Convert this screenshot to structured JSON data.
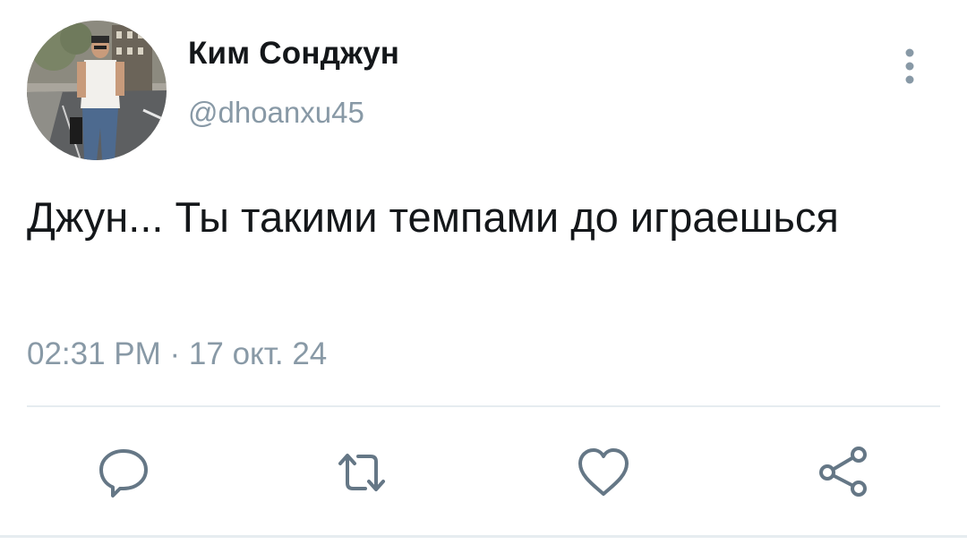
{
  "user": {
    "display_name": "Ким Сонджун",
    "handle": "@dhoanxu45"
  },
  "tweet": {
    "text": "Джун... Ты такими темпами до играешься",
    "timestamp": "02:31 PM · 17 окт. 24"
  },
  "icons": {
    "more": "more-vertical-icon",
    "reply": "reply-icon",
    "retweet": "retweet-icon",
    "like": "heart-icon",
    "share": "share-icon"
  },
  "colors": {
    "text_primary": "#14171a",
    "text_secondary": "#8899a6",
    "icon": "#657786",
    "divider": "#e6ecf0"
  }
}
